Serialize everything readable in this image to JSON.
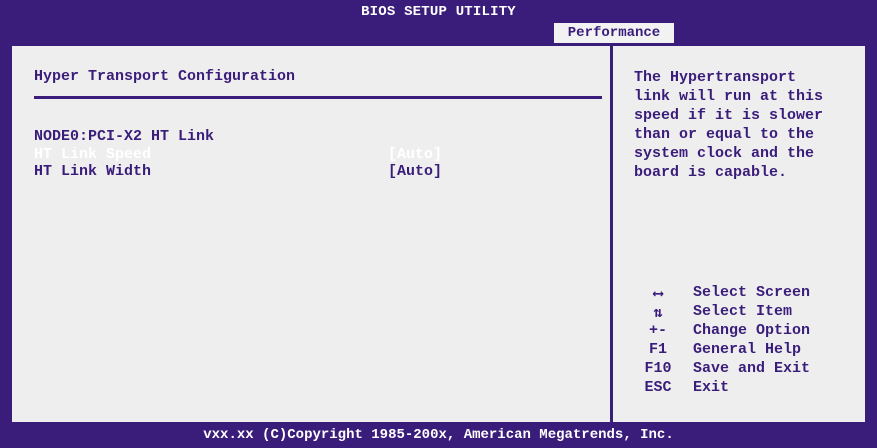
{
  "header": {
    "title": "BIOS SETUP UTILITY",
    "active_tab": "Performance"
  },
  "left": {
    "section_title": "Hyper Transport Configuration",
    "node_label": "NODE0:PCI-X2 HT Link",
    "settings": [
      {
        "label": "HT Link Speed",
        "value": "[Auto]"
      },
      {
        "label": "HT Link Width",
        "value": "[Auto]"
      }
    ]
  },
  "help": {
    "text": "The Hypertransport\nlink will run at this\nspeed if it is slower\nthan or equal to the\nsystem clock and the\nboard is capable."
  },
  "keys": [
    {
      "key": "⟷",
      "icon": "left-right-arrow-icon",
      "desc": "Select Screen"
    },
    {
      "key": "⇅",
      "icon": "up-down-arrow-icon",
      "desc": "Select Item"
    },
    {
      "key": "+-",
      "desc": "Change Option"
    },
    {
      "key": "F1",
      "desc": "General Help"
    },
    {
      "key": "F10",
      "desc": "Save and Exit"
    },
    {
      "key": "ESC",
      "desc": "Exit"
    }
  ],
  "footer": "vxx.xx (C)Copyright 1985-200x, American Megatrends, Inc.",
  "colors": {
    "background": "#3a1d7a",
    "panel": "#eeeeee",
    "text": "#3a1d7a",
    "highlight": "#ffffff"
  }
}
